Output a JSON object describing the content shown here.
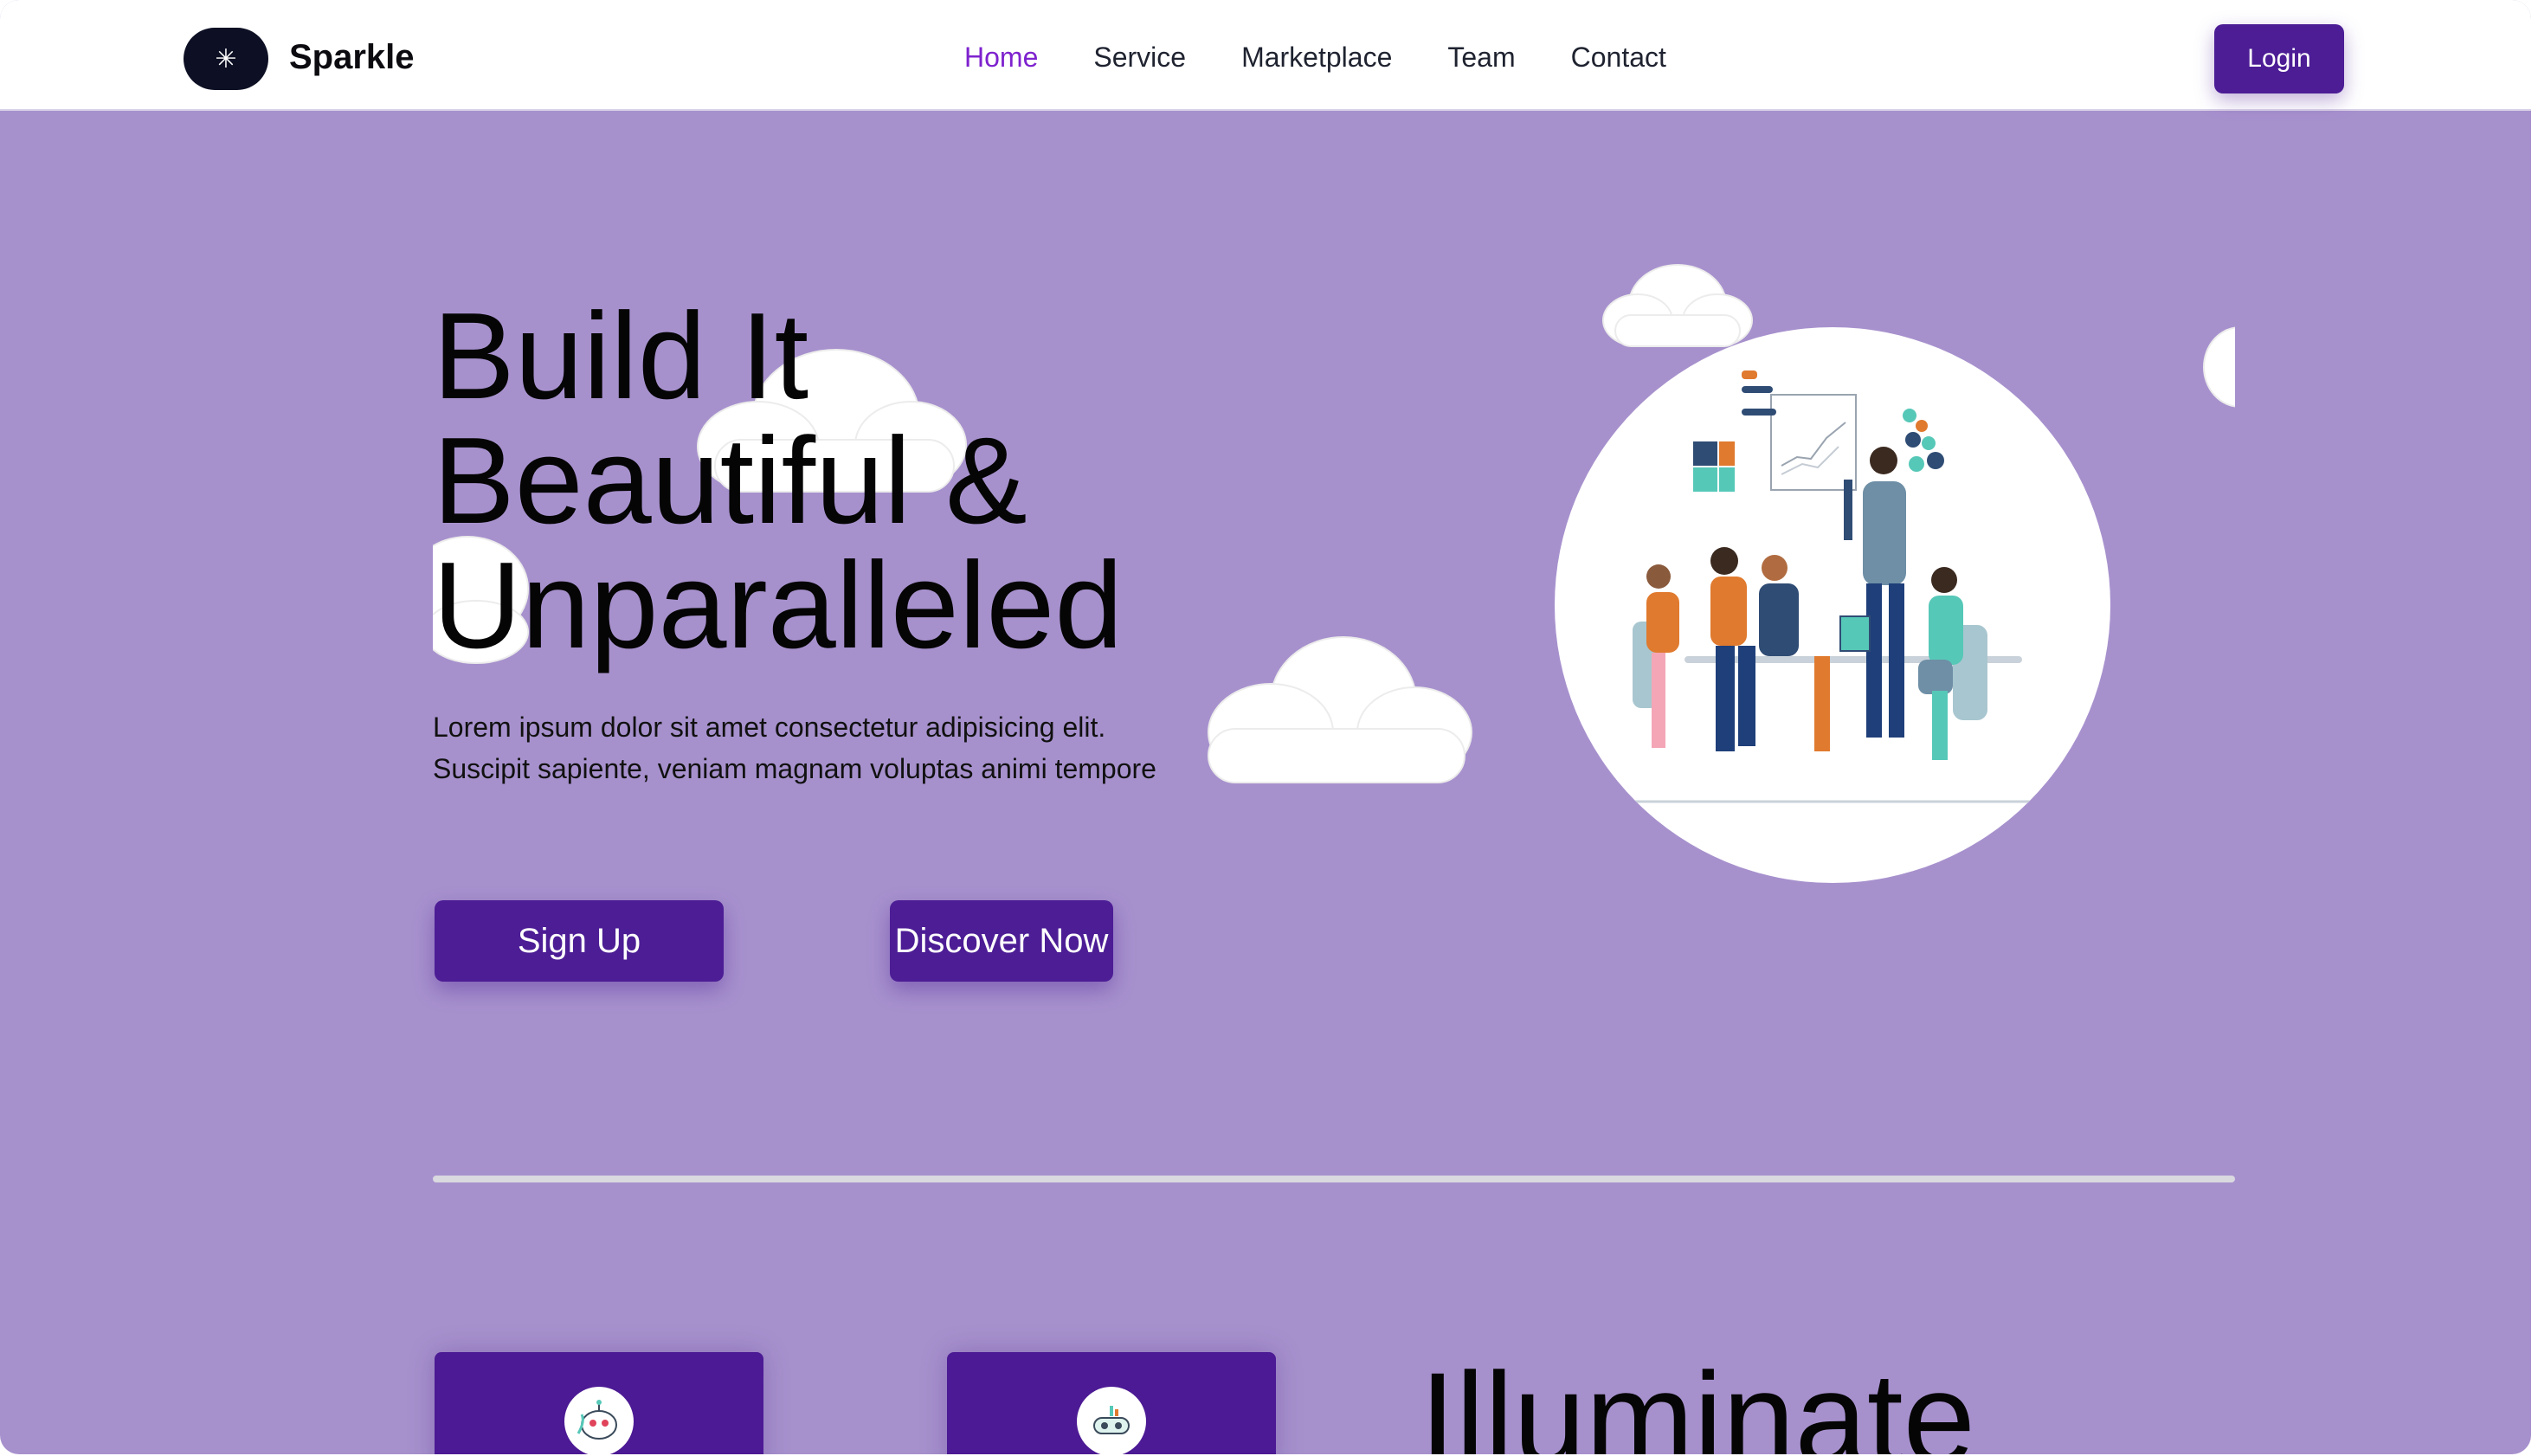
{
  "brand": {
    "name": "Sparkle",
    "logo_icon": "sparkle-icon",
    "logo_glyph": "✳"
  },
  "nav": {
    "links": [
      {
        "label": "Home",
        "active": true
      },
      {
        "label": "Service",
        "active": false
      },
      {
        "label": "Marketplace",
        "active": false
      },
      {
        "label": "Team",
        "active": false
      },
      {
        "label": "Contact",
        "active": false
      }
    ],
    "login_label": "Login"
  },
  "hero": {
    "title_lines": [
      "Build It",
      "Beautiful &",
      "Unparalleled"
    ],
    "description": "Lorem ipsum dolor sit amet consectetur adipisicing elit. Suscipit sapiente, veniam magnam voluptas animi tempore",
    "signup_label": "Sign Up",
    "discover_label": "Discover Now",
    "illustration_icon": "team-meeting-illustration"
  },
  "features": {
    "cards": [
      {
        "icon": "robot-icon"
      },
      {
        "icon": "gamepad-icon"
      }
    ],
    "heading": "Illuminate"
  },
  "colors": {
    "background": "#a791cd",
    "primary": "#4c1d95",
    "active_link": "#7e22ce",
    "nav_bg": "#ffffff"
  }
}
